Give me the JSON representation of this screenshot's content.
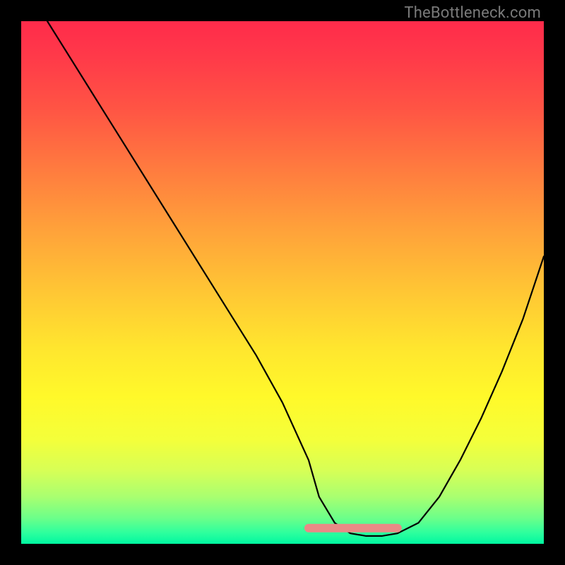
{
  "watermark": {
    "text": "TheBottleneck.com"
  },
  "chart_data": {
    "type": "line",
    "title": "",
    "xlabel": "",
    "ylabel": "",
    "xlim": [
      0,
      100
    ],
    "ylim": [
      0,
      100
    ],
    "grid": false,
    "series": [
      {
        "name": "curve",
        "color": "#000000",
        "x": [
          5,
          10,
          15,
          20,
          25,
          30,
          35,
          40,
          45,
          50,
          55,
          57,
          60,
          63,
          66,
          69,
          72,
          76,
          80,
          84,
          88,
          92,
          96,
          100
        ],
        "y": [
          100,
          92,
          84,
          76,
          68,
          60,
          52,
          44,
          36,
          27,
          16,
          9,
          4,
          2,
          1.5,
          1.5,
          2,
          4,
          9,
          16,
          24,
          33,
          43,
          55
        ]
      },
      {
        "name": "flat-bottom-highlight",
        "color": "#e98a86",
        "x": [
          55,
          72
        ],
        "y": [
          3,
          3
        ]
      }
    ],
    "background_gradient": {
      "direction": "vertical",
      "stops": [
        {
          "pos": 0.0,
          "color": "#ff2b4b"
        },
        {
          "pos": 0.28,
          "color": "#ff7a3f"
        },
        {
          "pos": 0.55,
          "color": "#ffe22e"
        },
        {
          "pos": 0.8,
          "color": "#f0ff40"
        },
        {
          "pos": 1.0,
          "color": "#00f7a0"
        }
      ]
    }
  }
}
